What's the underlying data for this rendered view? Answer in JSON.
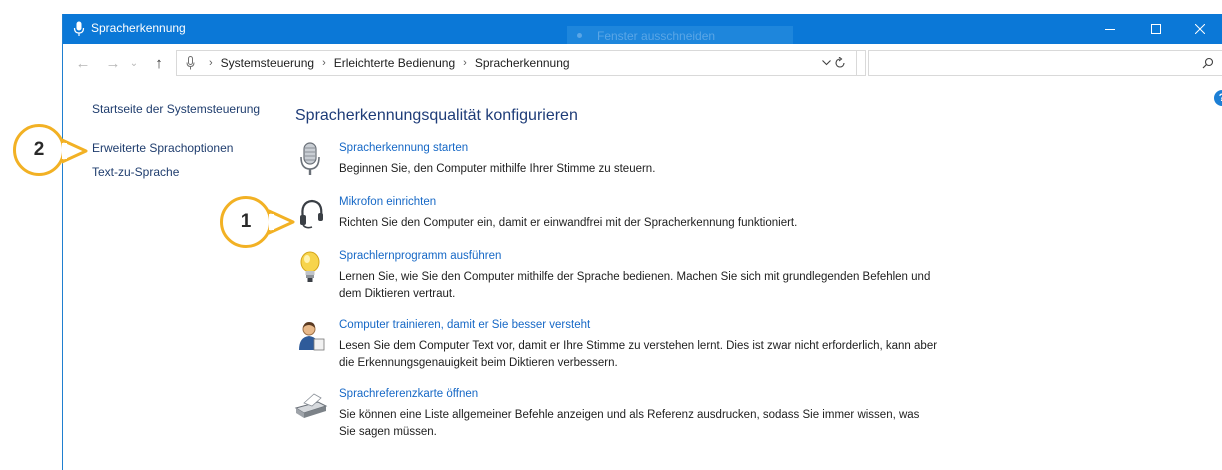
{
  "window": {
    "title": "Spracherkennung",
    "ghost_tooltip": "Fenster ausschneiden"
  },
  "address": {
    "breadcrumbs": [
      "Systemsteuerung",
      "Erleichterte Bedienung",
      "Spracherkennung"
    ],
    "search_placeholder": ""
  },
  "sidebar": {
    "items": [
      {
        "label": "Startseite der Systemsteuerung"
      },
      {
        "label": "Erweiterte Sprachoptionen"
      },
      {
        "label": "Text-zu-Sprache"
      }
    ]
  },
  "main": {
    "heading": "Spracherkennungsqualität konfigurieren",
    "tasks": [
      {
        "icon": "microphone-icon",
        "title": "Spracherkennung starten",
        "description": "Beginnen Sie, den Computer mithilfe Ihrer Stimme zu steuern."
      },
      {
        "icon": "headset-icon",
        "title": "Mikrofon einrichten",
        "description": "Richten Sie den Computer ein, damit er einwandfrei mit der Spracherkennung funktioniert."
      },
      {
        "icon": "lightbulb-icon",
        "title": "Sprachlernprogramm ausführen",
        "description": "Lernen Sie, wie Sie den Computer mithilfe der Sprache bedienen. Machen Sie sich mit grundlegenden Befehlen und dem Diktieren vertraut."
      },
      {
        "icon": "user-train-icon",
        "title": "Computer trainieren, damit er Sie besser versteht",
        "description": "Lesen Sie dem Computer Text vor, damit er Ihre Stimme zu verstehen lernt. Dies ist zwar nicht erforderlich, kann aber die Erkennungsgenauigkeit beim Diktieren verbessern."
      },
      {
        "icon": "printer-icon",
        "title": "Sprachreferenzkarte öffnen",
        "description": "Sie können eine Liste allgemeiner Befehle anzeigen und als Referenz ausdrucken, sodass Sie immer wissen, was Sie sagen müssen."
      }
    ]
  },
  "callouts": {
    "one": "1",
    "two": "2",
    "color": "#f2b124"
  },
  "colors": {
    "titlebar": "#0b78d7",
    "link": "#1668c6",
    "heading": "#1e3c78"
  }
}
